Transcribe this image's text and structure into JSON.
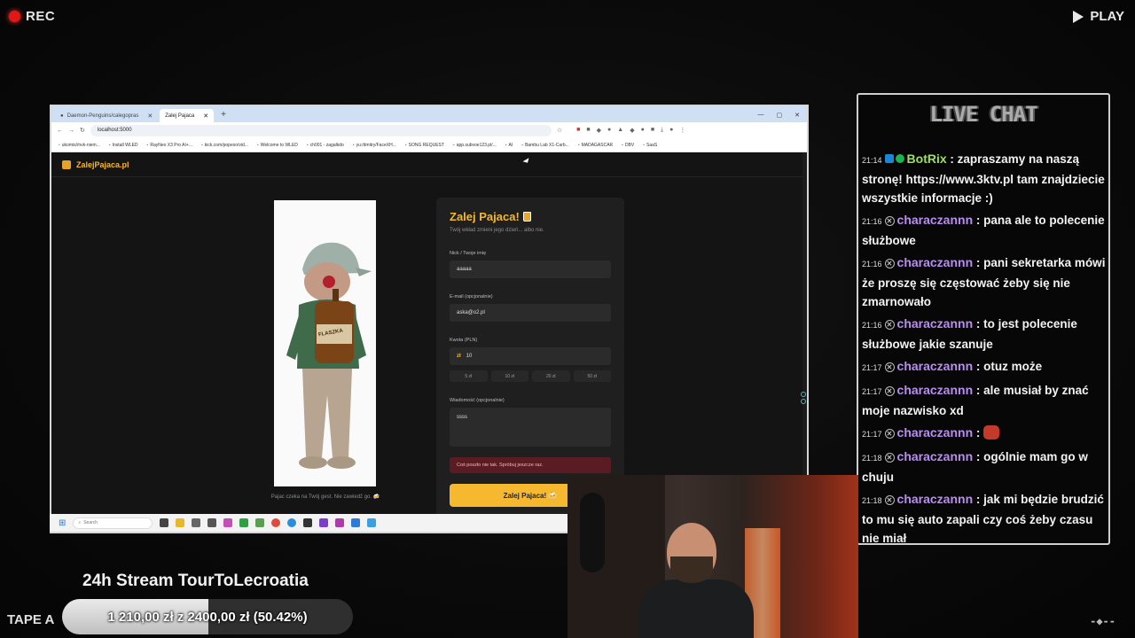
{
  "overlay": {
    "rec_label": "REC",
    "play_label": "PLAY",
    "tape_label": "TAPE A",
    "stream_title": "24h Stream TourToLecroatia",
    "goal_text": "1 210,00 zł z 2400,00 zł (50.42%)",
    "goal_fraction": 0.5042
  },
  "browser": {
    "tabs": [
      {
        "label": "Daemon-Penguins/calegopras"
      },
      {
        "label": "Zalej Pajaca"
      }
    ],
    "url": "localhost:5000",
    "bookmarks": [
      "ukomis//nvk-niem...",
      "Install WLED",
      "RayNeo X3 Pro AI+...",
      "kick.com/popexo/vid...",
      "Welcome to WLED",
      "ch001 - zagalkdo",
      "yu:/dmitry/FaceXH...",
      "SONG REQUEST",
      "app.subvoe123.pl/...",
      "AI",
      "Bambu Lab X1-Carb...",
      "MADAGASCAR",
      "DBV",
      "SaaS"
    ]
  },
  "site": {
    "logo": "ZalejPajaca.pl",
    "image_caption": "Pajac czeka na Twój gest. Nie zawiedź go. 🍻",
    "bottle_label": "FLASZKA",
    "form": {
      "title": "Zalej Pajaca!",
      "subtitle": "Twój wkład zmieni jego dzień... albo nie.",
      "nick_label": "Nick / Twoje imię",
      "nick_value": "aaaaa",
      "email_label": "E-mail (opcjonalnie)",
      "email_value": "aska@o2.pl",
      "amount_label": "Kwota (PLN)",
      "amount_prefix": "zł",
      "amount_value": "10",
      "chips": [
        "5 zł",
        "10 zł",
        "20 zł",
        "50 zł"
      ],
      "message_label": "Wiadomość (opcjonalnie)",
      "message_value": "ssss",
      "error": "Coś poszło nie tak. Spróbuj jeszcze raz.",
      "submit_label": "Zalej Pajaca! 🍻"
    }
  },
  "taskbar": {
    "search_placeholder": "Search"
  },
  "chat": {
    "header": "LIVE CHAT",
    "messages": [
      {
        "time": "21:14",
        "user": "BotRix",
        "user_color": "#9be25b",
        "text": "zapraszamy na naszą stronę! https://www.3ktv.pl tam znajdziecie wszystkie informacje :)"
      },
      {
        "time": "21:16",
        "user": "characzannn",
        "user_color": "#b98df2",
        "text": "pana ale to polecenie służbowe"
      },
      {
        "time": "21:16",
        "user": "characzannn",
        "user_color": "#b98df2",
        "text": "pani sekretarka mówi że proszę się częstować żeby się nie zmarnowało"
      },
      {
        "time": "21:16",
        "user": "characzannn",
        "user_color": "#b98df2",
        "text": "to jest polecenie służbowe jakie szanuje"
      },
      {
        "time": "21:17",
        "user": "characzannn",
        "user_color": "#b98df2",
        "text": "otuz może"
      },
      {
        "time": "21:17",
        "user": "characzannn",
        "user_color": "#b98df2",
        "text": "ale musiał by znać moje nazwisko xd"
      },
      {
        "time": "21:17",
        "user": "characzannn",
        "user_color": "#b98df2",
        "text": ""
      },
      {
        "time": "21:18",
        "user": "characzannn",
        "user_color": "#b98df2",
        "text": "ogólnie mam go w chuju"
      },
      {
        "time": "21:18",
        "user": "characzannn",
        "user_color": "#b98df2",
        "text": "jak mi będzie brudzić to mu się auto zapali czy coś żeby czasu nie miał"
      }
    ]
  },
  "colors": {
    "accent": "#f5b82e",
    "error_bg": "#5a1c22",
    "rec": "#e01818"
  }
}
